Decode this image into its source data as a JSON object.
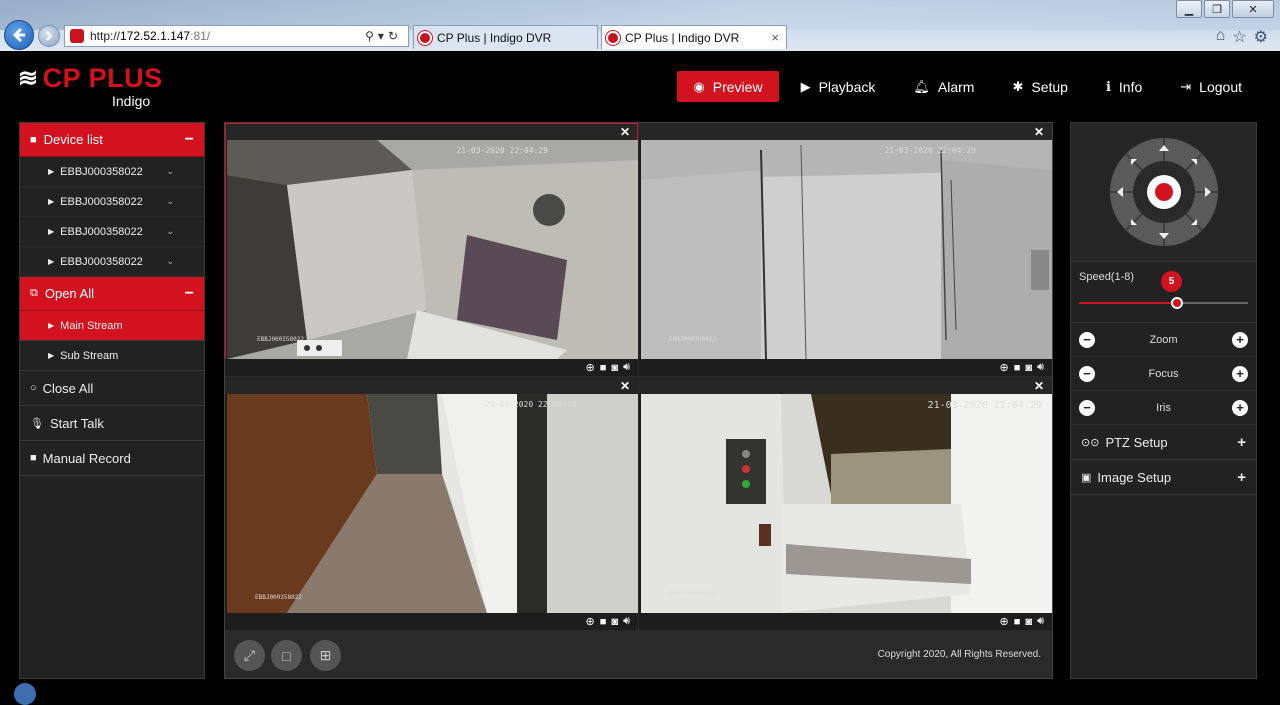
{
  "browser": {
    "url_prefix": "http://",
    "url_host": "172.52.1.147",
    "url_port": ":81/",
    "tabs": [
      {
        "title": "CP Plus | Indigo DVR"
      },
      {
        "title": "CP Plus | Indigo DVR",
        "close": "×"
      }
    ],
    "window_controls": [
      "▁",
      "❐",
      "✕"
    ]
  },
  "app": {
    "logo_main": "CP PLUS",
    "logo_sub": "Indigo",
    "nav": [
      {
        "label": "Preview",
        "icon": "eye-icon",
        "active": true
      },
      {
        "label": "Playback",
        "icon": "play-circle-icon"
      },
      {
        "label": "Alarm",
        "icon": "bell-icon"
      },
      {
        "label": "Setup",
        "icon": "gear-icon"
      },
      {
        "label": "Info",
        "icon": "info-icon"
      },
      {
        "label": "Logout",
        "icon": "logout-icon"
      }
    ],
    "accent_color": "#d2121e"
  },
  "sidebar": {
    "device_list": {
      "label": "Device list",
      "toggle": "−"
    },
    "devices": [
      "EBBJ000358022",
      "EBBJ000358022",
      "EBBJ000358022",
      "EBBJ000358022"
    ],
    "open_all": {
      "label": "Open All",
      "toggle": "−"
    },
    "streams": [
      "Main Stream",
      "Sub Stream"
    ],
    "close_all": "Close All",
    "start_talk": "Start Talk",
    "manual_record": "Manual Record"
  },
  "video": {
    "panes": [
      {
        "timestamp": "21-03-2020 22:04:29",
        "camera_label": "EBBJ000358022"
      },
      {
        "timestamp": "21-03-2020 22:04:29",
        "camera_label": "EBBJ000358022"
      },
      {
        "timestamp": "21-03-2020 22:04:28",
        "camera_label": "EBBJ000358022"
      },
      {
        "timestamp": "21-03-2020 22:04:29",
        "camera_label": "EBBJ000358022"
      }
    ],
    "copyright": "Copyright 2020, All Rights Reserved."
  },
  "ptz": {
    "speed_label": "Speed(1-8)",
    "speed_value": "5",
    "speed_fraction": 0.58,
    "controls": [
      "Zoom",
      "Focus",
      "Iris"
    ],
    "ptz_setup": "PTZ Setup",
    "image_setup": "Image Setup"
  }
}
